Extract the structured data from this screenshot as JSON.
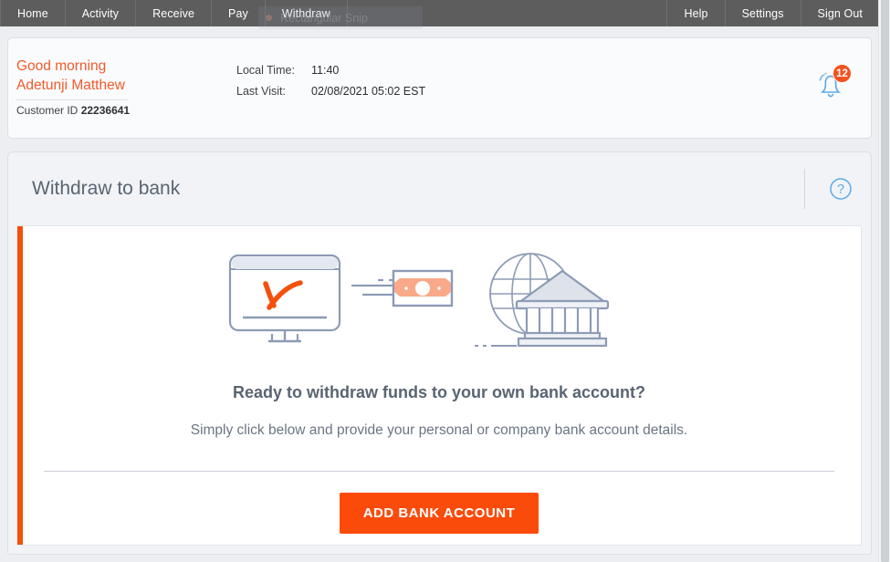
{
  "nav": {
    "left_items": [
      {
        "label": "Home",
        "active": false
      },
      {
        "label": "Activity",
        "active": false
      },
      {
        "label": "Receive",
        "active": false
      },
      {
        "label": "Pay",
        "active": false
      },
      {
        "label": "Withdraw",
        "active": true
      }
    ],
    "right_items": [
      {
        "label": "Help"
      },
      {
        "label": "Settings"
      },
      {
        "label": "Sign Out"
      }
    ]
  },
  "snip_overlay": {
    "label": "Rectangular Snip"
  },
  "greeting": {
    "salutation": "Good morning",
    "user_name": "Adetunji Matthew",
    "customer_id_label": "Customer ID",
    "customer_id_value": "22236641",
    "local_time_label": "Local Time:",
    "local_time_value": "11:40",
    "last_visit_label": "Last Visit:",
    "last_visit_value": "02/08/2021 05:02 EST",
    "notification_count": "12"
  },
  "panel": {
    "title": "Withdraw to bank",
    "help_icon": "question-mark-circle-icon",
    "headline": "Ready to withdraw funds to your own bank account?",
    "subline": "Simply click below and provide your personal or company bank account details.",
    "cta_label": "ADD BANK ACCOUNT"
  },
  "colors": {
    "accent_orange": "#f4500a",
    "cta_orange": "#fb4b0b",
    "brand_text_orange": "#f15a29",
    "badge_orange": "#f4511e",
    "nav_gray": "#5d5d5d",
    "title_slate": "#5a6472",
    "illustration_blue": "#8d9bb5"
  }
}
